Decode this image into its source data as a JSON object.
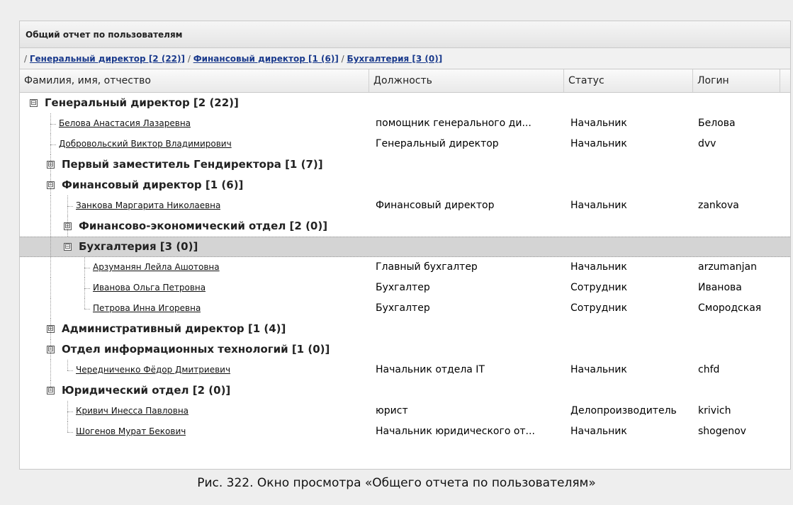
{
  "panel_title": "Общий отчет по пользователям",
  "breadcrumb": {
    "lead": "/",
    "items": [
      "Генеральный директор [2 (22)]",
      "Финансовый директор [1 (6)]",
      "Бухгалтерия [3 (0)]"
    ],
    "sep": "/"
  },
  "columns": [
    "Фамилия, имя, отчество",
    "Должность",
    "Статус",
    "Логин"
  ],
  "rows": [
    {
      "type": "group",
      "name": "Генеральный директор [2 (22)]",
      "toggle": "⊟"
    },
    {
      "type": "user",
      "name": "Белова Анастасия Лазаревна",
      "position": "помощник генерального ди...",
      "status": "Начальник",
      "login": "Белова"
    },
    {
      "type": "user",
      "name": "Добровольский Виктор Владимирович",
      "position": "Генеральный директор",
      "status": "Начальник",
      "login": "dvv"
    },
    {
      "type": "group",
      "name": "Первый заместитель Гендиректора [1 (7)]",
      "toggle": "⊞"
    },
    {
      "type": "group",
      "name": "Финансовый директор [1 (6)]",
      "toggle": "⊟"
    },
    {
      "type": "user",
      "name": "Занкова Маргарита Николаевна",
      "position": "Финансовый директор",
      "status": "Начальник",
      "login": "zankova"
    },
    {
      "type": "group",
      "name": "Финансово-экономический отдел [2 (0)]",
      "toggle": "⊞"
    },
    {
      "type": "group",
      "name": "Бухгалтерия [3 (0)]",
      "toggle": "⊟"
    },
    {
      "type": "user",
      "name": "Арзуманян Лейла Ашотовна",
      "position": "Главный бухгалтер",
      "status": "Начальник",
      "login": "arzumanjan"
    },
    {
      "type": "user",
      "name": "Иванова Ольга Петровна",
      "position": "Бухгалтер",
      "status": "Сотрудник",
      "login": "Иванова"
    },
    {
      "type": "user",
      "name": "Петрова Инна Игоревна",
      "position": "Бухгалтер",
      "status": "Сотрудник",
      "login": "Смородская"
    },
    {
      "type": "group",
      "name": "Административный директор [1 (4)]",
      "toggle": "⊞"
    },
    {
      "type": "group",
      "name": "Отдел информационных технологий [1 (0)]",
      "toggle": "⊟"
    },
    {
      "type": "user",
      "name": "Чередниченко Фёдор Дмитриевич",
      "position": "Начальник отдела IT",
      "status": "Начальник",
      "login": "chfd"
    },
    {
      "type": "group",
      "name": "Юридический отдел [2 (0)]",
      "toggle": "⊟"
    },
    {
      "type": "user",
      "name": "Кривич Инесса Павловна",
      "position": "юрист",
      "status": "Делопроизводитель",
      "login": "krivich"
    },
    {
      "type": "user",
      "name": "Шогенов Мурат Бекович",
      "position": "Начальник юридического от...",
      "status": "Начальник",
      "login": "shogenov"
    }
  ],
  "caption": "Рис. 322. Окно просмотра «Общего отчета по пользователям»"
}
